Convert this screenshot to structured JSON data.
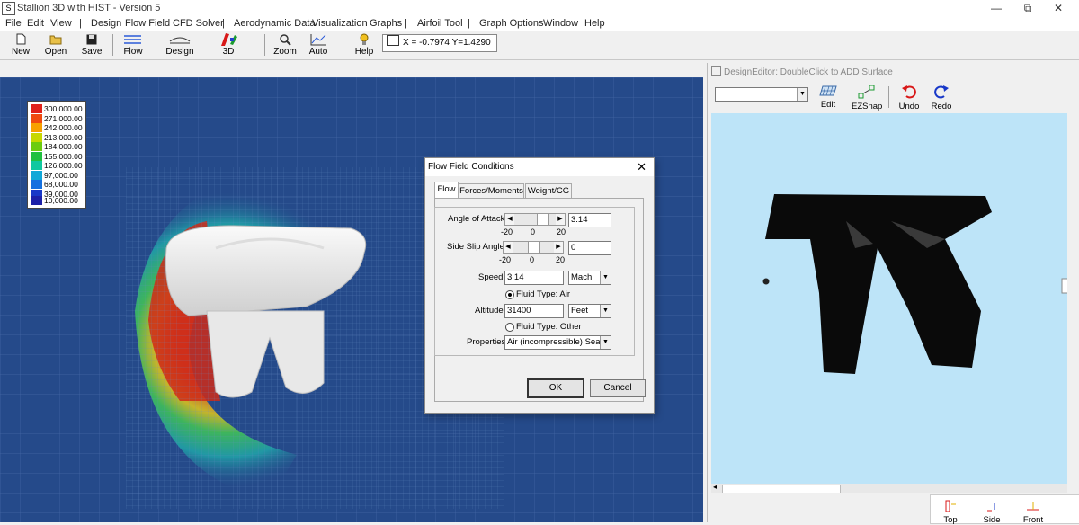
{
  "window": {
    "title": "Stallion 3D with HIST - Version 5",
    "app_icon": "stallion-app-icon",
    "controls": [
      "—",
      "⧉",
      "✕"
    ]
  },
  "menu": [
    "File",
    "Edit",
    "View",
    "|",
    "Design",
    "Flow Field",
    "CFD Solver",
    "|",
    "Aerodynamic Data",
    "Visualization",
    "Graphs",
    "|",
    "Airfoil Tool",
    "|",
    "Graph Options",
    "Window",
    "Help"
  ],
  "toolbar": {
    "new": "New",
    "open": "Open",
    "save": "Save",
    "flow": "Flow",
    "design": "Design",
    "threed": "3D",
    "zoom": "Zoom",
    "auto": "Auto",
    "help": "Help",
    "coords": "X = -0.7974  Y=1.4290"
  },
  "legend": {
    "values": [
      "300,000.00",
      "271,000.00",
      "242,000.00",
      "213,000.00",
      "184,000.00",
      "155,000.00",
      "126,000.00",
      "97,000.00",
      "68,000.00",
      "39,000.00",
      "10,000.00"
    ],
    "colors": [
      "#e0201a",
      "#f04a10",
      "#f8a000",
      "#c8d800",
      "#6ccc10",
      "#20c040",
      "#10c8a0",
      "#10a8d8",
      "#1470e0",
      "#1838c8",
      "#1c20a8"
    ]
  },
  "dialog": {
    "title": "Flow Field Conditions",
    "close": "✕",
    "tabs": [
      "Flow",
      "Forces/Moments",
      "Weight/CG"
    ],
    "angle_of_attack": {
      "label": "Angle of Attack:",
      "value": "3.14",
      "min": "-20",
      "mid": "0",
      "max": "20"
    },
    "side_slip": {
      "label": "Side Slip Angle:",
      "value": "0",
      "min": "-20",
      "mid": "0",
      "max": "20"
    },
    "speed": {
      "label": "Speed:",
      "value": "3.14",
      "unit": "Mach"
    },
    "fluid_air": "Fluid Type: Air",
    "altitude": {
      "label": "Altitude:",
      "value": "31400",
      "unit": "Feet"
    },
    "fluid_other": "Fluid Type: Other",
    "properties": {
      "label": "Properties:",
      "value": "Air (incompressible) Sea Level"
    },
    "ok": "OK",
    "cancel": "Cancel"
  },
  "design_editor": {
    "title": "DesignEditor: DoubleClick to ADD Surface",
    "combo_value": "",
    "edit": "Edit",
    "ezsnap": "EZSnap",
    "undo": "Undo",
    "redo": "Redo",
    "views": [
      "Top",
      "Side",
      "Front"
    ]
  }
}
